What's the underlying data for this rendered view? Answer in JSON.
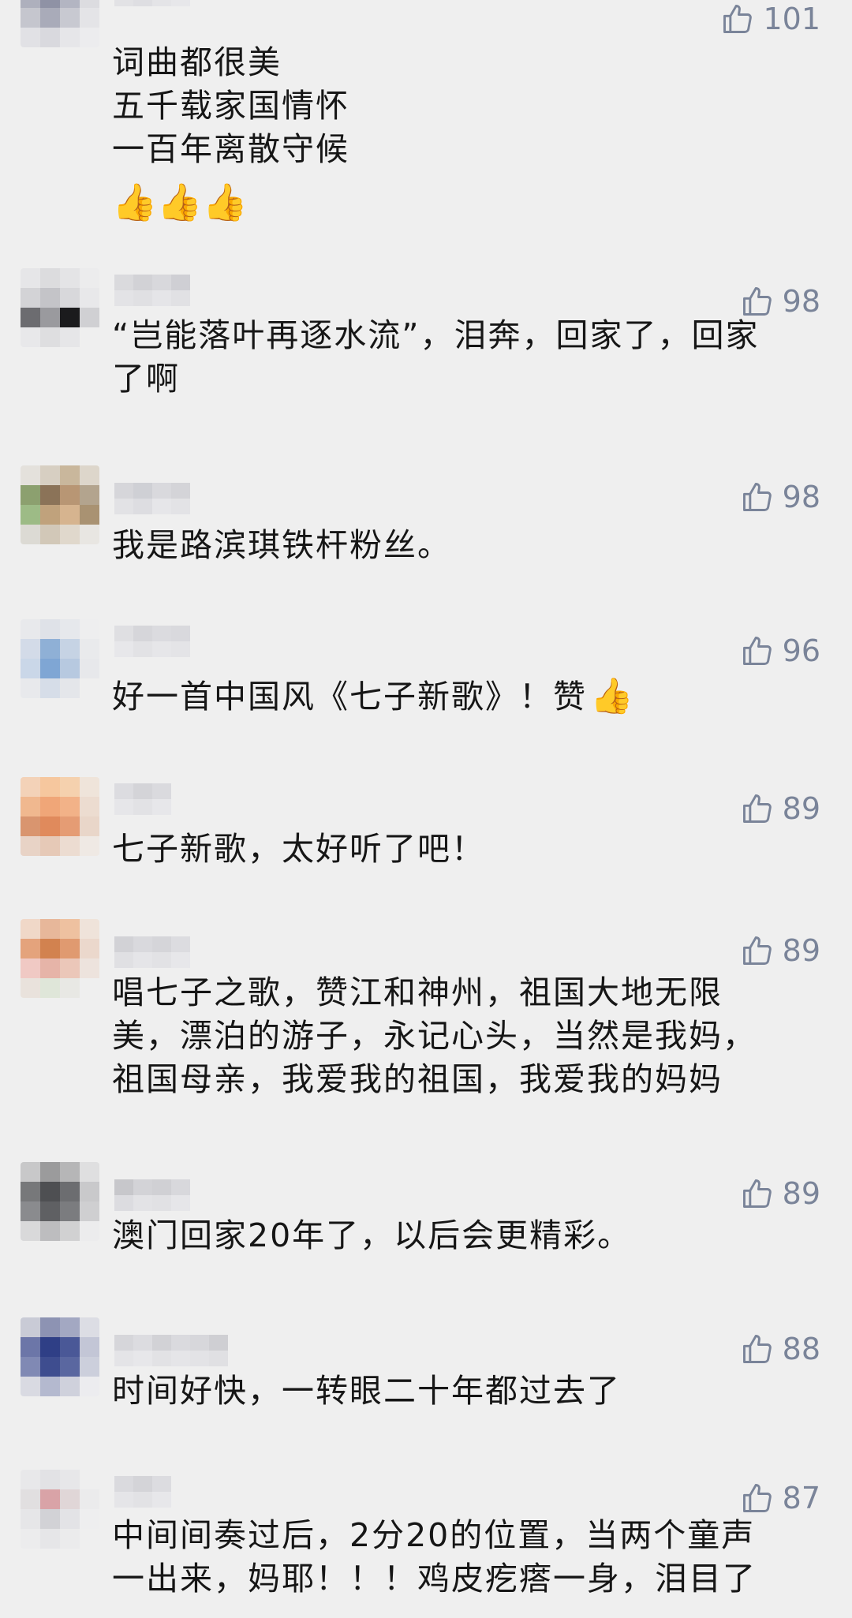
{
  "comments": [
    {
      "likes": "101",
      "lines": "词曲都很美\n五千载家国情怀\n一百年离散守候",
      "emoji": "👍👍👍"
    },
    {
      "likes": "98",
      "lines": "“岂能落叶再逐水流”，泪奔，回家了，回家\n了啊"
    },
    {
      "likes": "98",
      "lines": "我是路滨琪铁杆粉丝。"
    },
    {
      "likes": "96",
      "lines": "好一首中国风《七子新歌》！赞",
      "emoji": "👍"
    },
    {
      "likes": "89",
      "lines": "七子新歌，太好听了吧！"
    },
    {
      "likes": "89",
      "lines": "唱七子之歌，赞江和神州，祖国大地无限\n美，漂泊的游子，永记心头，当然是我妈，\n祖国母亲，我爱我的祖国，我爱我的妈妈"
    },
    {
      "likes": "89",
      "lines": "澳门回家20年了，以后会更精彩。"
    },
    {
      "likes": "88",
      "lines": "时间好快，一转眼二十年都过去了"
    },
    {
      "likes": "87",
      "lines": "中间间奏过后，2分20的位置，当两个童声\n一出来，妈耶！！！鸡皮疙瘩一身，泪目了"
    }
  ],
  "icons": {
    "like": "thumbs-up-icon"
  },
  "colors": {
    "background": "#efefef",
    "text": "#161616",
    "like": "#7a8499"
  }
}
